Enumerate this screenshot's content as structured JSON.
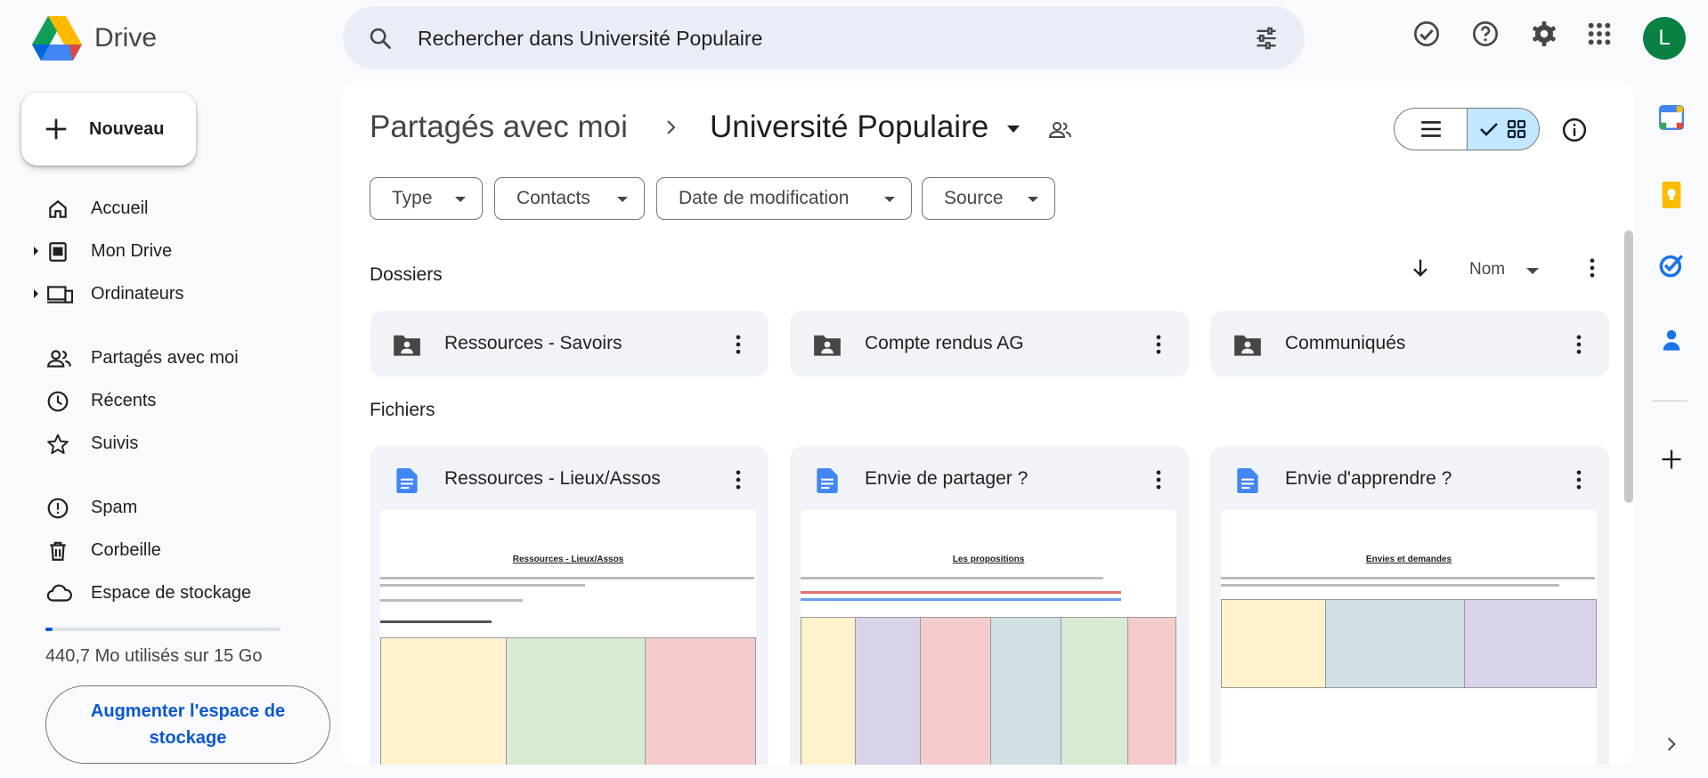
{
  "app": {
    "name": "Drive"
  },
  "search": {
    "placeholder": "Rechercher dans Université Populaire"
  },
  "account": {
    "initial": "L",
    "color": "#0b8043"
  },
  "sidebar": {
    "new_label": "Nouveau",
    "items": [
      {
        "label": "Accueil",
        "icon": "home-icon"
      },
      {
        "label": "Mon Drive",
        "icon": "my-drive-icon"
      },
      {
        "label": "Ordinateurs",
        "icon": "computers-icon"
      },
      {
        "label": "Partagés avec moi",
        "icon": "shared-icon"
      },
      {
        "label": "Récents",
        "icon": "clock-icon"
      },
      {
        "label": "Suivis",
        "icon": "star-icon"
      },
      {
        "label": "Spam",
        "icon": "spam-icon"
      },
      {
        "label": "Corbeille",
        "icon": "trash-icon"
      },
      {
        "label": "Espace de stockage",
        "icon": "cloud-icon"
      }
    ],
    "storage_text": "440,7 Mo utilisés sur 15 Go",
    "storage_fraction": 0.03,
    "upgrade_label": "Augmenter l'espace de stockage"
  },
  "breadcrumb": {
    "root": "Partagés avec moi",
    "current": "Université Populaire"
  },
  "filters": [
    "Type",
    "Contacts",
    "Date de modification",
    "Source"
  ],
  "sections": {
    "folders": "Dossiers",
    "files": "Fichiers"
  },
  "sort": {
    "label": "Nom"
  },
  "folders": [
    "Ressources - Savoirs",
    "Compte rendus AG",
    "Communiqués"
  ],
  "files": [
    {
      "name": "Ressources - Lieux/Assos",
      "preview_title": "Ressources - Lieux/Assos"
    },
    {
      "name": "Envie de partager ?",
      "preview_title": "Les propositions"
    },
    {
      "name": "Envie d'apprendre ?",
      "preview_title": "Envies et demandes"
    }
  ],
  "colors": {
    "accent": "#0b57d0",
    "selected": "#c2e7ff",
    "surface": "#f0f4f9"
  }
}
